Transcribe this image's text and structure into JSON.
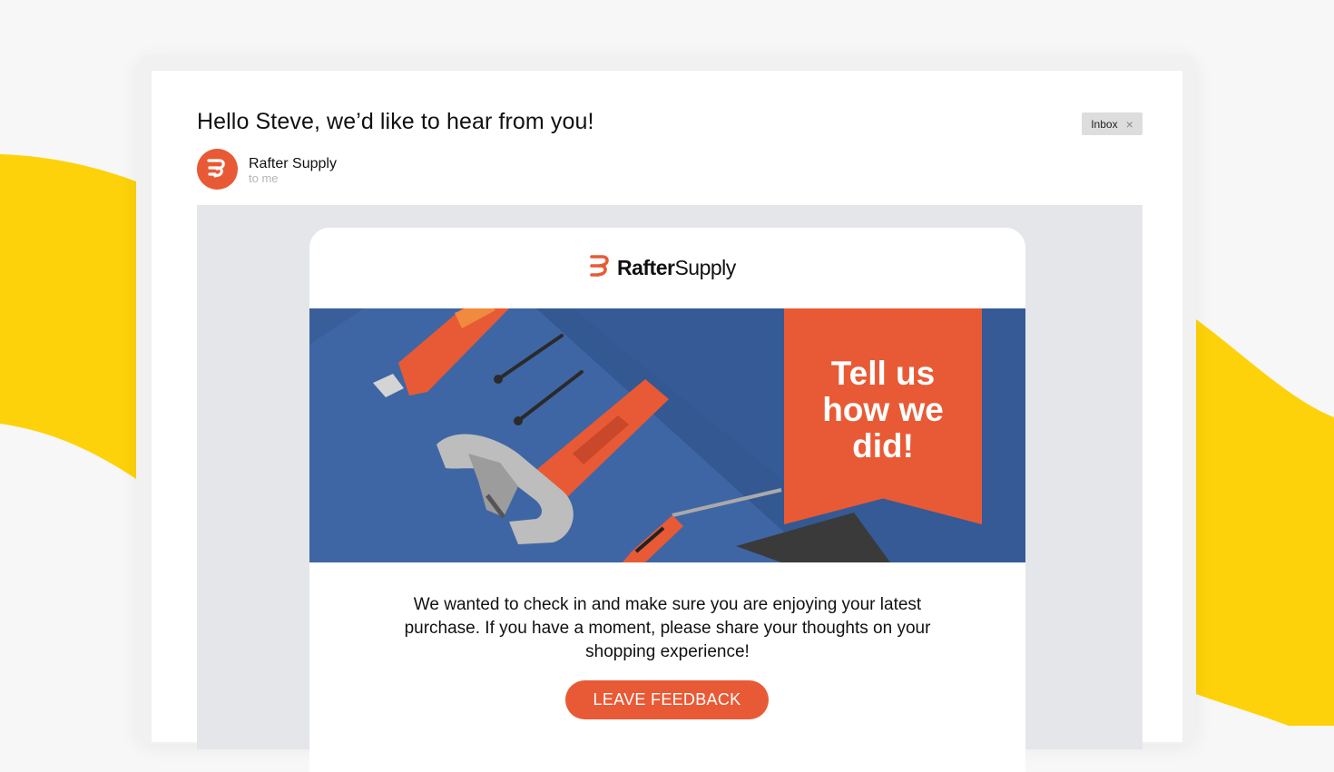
{
  "email": {
    "subject": "Hello Steve, we’d like to hear from you!",
    "label": "Inbox",
    "label_close_icon": "×",
    "sender_name": "Rafter Supply",
    "recipient": "to me"
  },
  "message": {
    "brand_bold": "Rafter",
    "brand_regular": "Supply",
    "banner_text": "Tell us\nhow we\ndid!",
    "body": "We wanted to check in and make sure you are enjoying your latest purchase. If you have a moment, please share your thoughts on your shopping experience!",
    "cta_label": "LEAVE FEEDBACK"
  },
  "colors": {
    "brand_orange": "#e85a35",
    "hero_blue": "#3f66a4",
    "background_yellow": "#fdd20a"
  },
  "icons": {
    "sender_avatar": "rafter-supply-logo-icon",
    "hero_image": "tools-hammer-utility-knife-nails-screwdriver"
  }
}
